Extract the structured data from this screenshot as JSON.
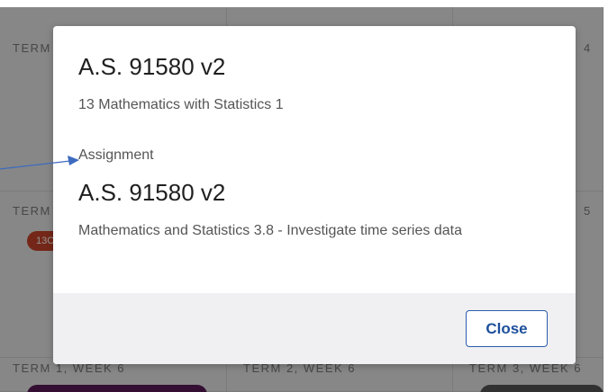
{
  "calendar": {
    "labels": {
      "row1_col1": "TERM",
      "row1_col3": "4",
      "row2_col1": "TERM",
      "row2_col3": "5",
      "row3_col1": "TERM 1, WEEK 6",
      "row3_col2": "TERM 2, WEEK 6",
      "row3_col3": "TERM 3, WEEK 6"
    },
    "pill_label": "13C"
  },
  "modal": {
    "title": "A.S. 91580 v2",
    "subtitle": "13 Mathematics with Statistics 1",
    "type": "Assignment",
    "title_2": "A.S. 91580 v2",
    "description": "Mathematics and Statistics 3.8 - Investigate time series data",
    "close_label": "Close"
  },
  "colors": {
    "accent": "#2a5dab",
    "pill_red": "#c9442a",
    "pill_purple": "#5a1a58",
    "arrow": "#3d6bbf"
  }
}
